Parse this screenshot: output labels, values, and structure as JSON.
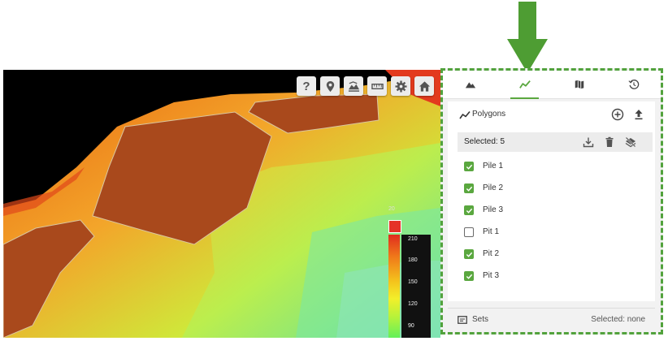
{
  "toolbar": {
    "buttons": [
      {
        "label": "?",
        "icon": "help-icon"
      },
      {
        "icon": "location-pin-icon"
      },
      {
        "icon": "terrain-layers-icon"
      },
      {
        "icon": "ruler-icon"
      },
      {
        "icon": "gear-icon"
      },
      {
        "icon": "home-icon"
      }
    ]
  },
  "legend": {
    "top_value": "20",
    "ticks": [
      "210",
      "180",
      "150",
      "120",
      "90"
    ],
    "colors": [
      "#e02c1e",
      "#f07b1a",
      "#f4c21c",
      "#f3ef2a",
      "#63f05a"
    ]
  },
  "panel": {
    "tabs": [
      {
        "icon": "mountain-icon",
        "active": false
      },
      {
        "icon": "polyline-icon",
        "active": true
      },
      {
        "icon": "map-icon",
        "active": false
      },
      {
        "icon": "history-icon",
        "active": false
      }
    ],
    "polygons": {
      "title": "Polygons",
      "selected_label": "Selected: 5",
      "items": [
        {
          "label": "Pile 1",
          "checked": true
        },
        {
          "label": "Pile 2",
          "checked": true
        },
        {
          "label": "Pile 3",
          "checked": true
        },
        {
          "label": "Pit 1",
          "checked": false
        },
        {
          "label": "Pit 2",
          "checked": true
        },
        {
          "label": "Pit 3",
          "checked": true
        }
      ]
    },
    "sets": {
      "label": "Sets",
      "selected": "Selected: none"
    }
  },
  "colors": {
    "accent": "#5aa73f",
    "highlight_border": "#52a23d",
    "arrow": "#4e9d33"
  }
}
